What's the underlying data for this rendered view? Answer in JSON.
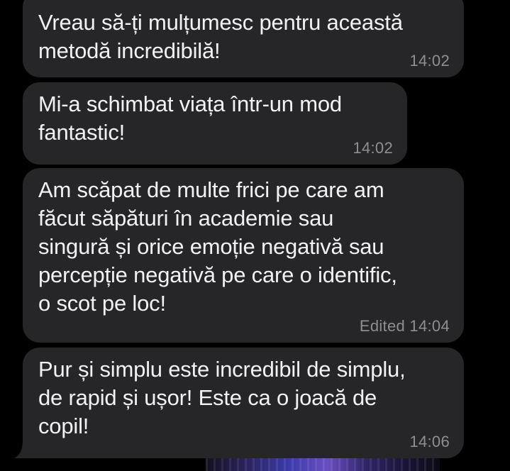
{
  "messages": [
    {
      "text": "Vreau să-ți mulțumesc pentru această\nmetodă incredibilă!",
      "time": "14:02"
    },
    {
      "text": "Mi-a schimbat viața într-un mod\nfantastic!",
      "time": "14:02"
    },
    {
      "text": "Am scăpat de multe frici pe care am\nfăcut săpături în academie sau\nsingură și orice emoție negativă sau\npercepție negativă pe care o identific,\no scot pe loc!",
      "time": "Edited 14:04"
    },
    {
      "text": "Pur și simplu este incredibil de simplu,\nde rapid și ușor! Este ca o joacă de\ncopil!",
      "time": "14:06"
    }
  ],
  "colors": {
    "background": "#000000",
    "bubble": "#262628",
    "text": "#f2f2f4",
    "meta": "#8e8e93"
  }
}
